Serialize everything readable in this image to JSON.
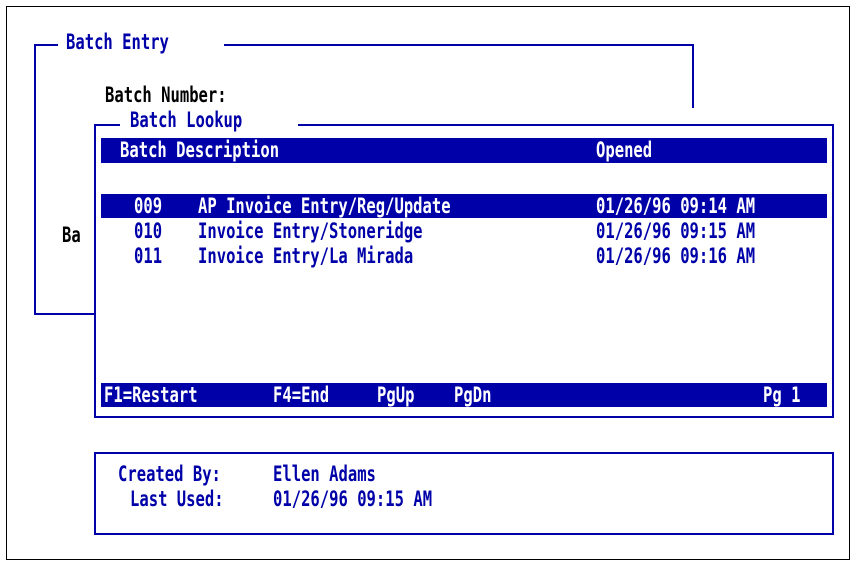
{
  "batch_entry": {
    "title": "Batch Entry",
    "batch_number_label": "Batch Number:",
    "partial_label": "Ba"
  },
  "lookup": {
    "title": "Batch Lookup",
    "headers": {
      "batch_description": "Batch Description",
      "opened": "Opened"
    },
    "rows": [
      {
        "num": "009",
        "desc": "AP Invoice Entry/Reg/Update",
        "opened": "01/26/96 09:14 AM",
        "selected": true
      },
      {
        "num": "010",
        "desc": "Invoice Entry/Stoneridge",
        "opened": "01/26/96 09:15 AM",
        "selected": false
      },
      {
        "num": "011",
        "desc": "Invoice Entry/La Mirada",
        "opened": "01/26/96 09:16 AM",
        "selected": false
      }
    ],
    "footer": {
      "f1": "F1=Restart",
      "f4": "F4=End",
      "pgup": "PgUp",
      "pgdn": "PgDn",
      "page": "Pg 1"
    }
  },
  "details": {
    "created_by_label": "Created By:",
    "created_by_value": "Ellen Adams",
    "last_used_label": "Last Used:",
    "last_used_value": "01/26/96 09:15 AM"
  },
  "colors": {
    "navy": "#0000a8",
    "black": "#000000",
    "white": "#ffffff"
  }
}
